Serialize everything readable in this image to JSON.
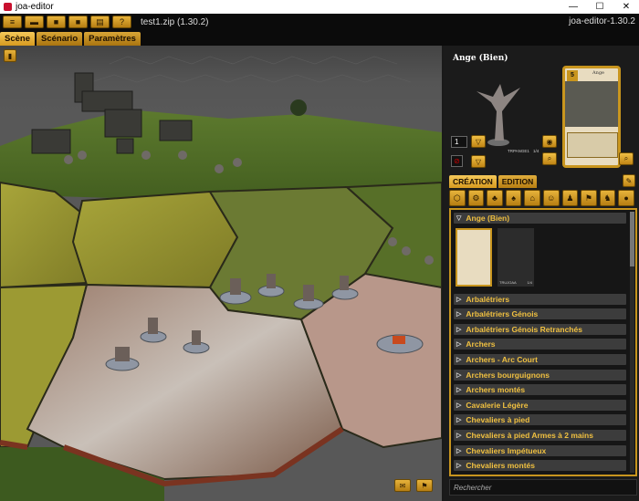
{
  "window": {
    "title": "joa-editor",
    "minimize": "—",
    "maximize": "☐",
    "close": "✕"
  },
  "toolbar": {
    "file_name": "test1.zip (1.30.2)",
    "app_version": "joa-editor-1.30.2",
    "buttons": [
      {
        "name": "menu-button",
        "icon": "menu-icon",
        "glyph": "≡"
      },
      {
        "name": "open-button",
        "icon": "folder-icon",
        "glyph": "▬"
      },
      {
        "name": "save-button",
        "icon": "floppy-icon",
        "glyph": "■"
      },
      {
        "name": "save-as-button",
        "icon": "floppy-plus-icon",
        "glyph": "■"
      },
      {
        "name": "print-button",
        "icon": "printer-icon",
        "glyph": "▤"
      },
      {
        "name": "help-button",
        "icon": "help-icon",
        "glyph": "?"
      }
    ]
  },
  "tabs": [
    {
      "label": "Scène",
      "active": true
    },
    {
      "label": "Scénario",
      "active": false
    },
    {
      "label": "Paramètres",
      "active": false
    }
  ],
  "preview": {
    "title": "Ange (Bien)",
    "quantity": "1",
    "card_label": "TRPANGE1",
    "card_count": "1/4",
    "card_name": "Ange"
  },
  "creation": {
    "tabs": [
      {
        "label": "CRÉATION",
        "active": true
      },
      {
        "label": "EDITION",
        "active": false
      }
    ],
    "categories": [
      "token-icon",
      "gear-icon",
      "group-icon",
      "tree-icon",
      "house-icon",
      "people-icon",
      "person-icon",
      "flag-icon",
      "horse-icon",
      "disc-icon"
    ],
    "expanded": {
      "label": "Ange (Bien)",
      "thumb_label": "TRUJOAA",
      "thumb_count": "1/4"
    },
    "items": [
      "Arbalétriers",
      "Arbalétriers Génois",
      "Arbalétriers Génois Retranchés",
      "Archers",
      "Archers - Arc Court",
      "Archers bourguignons",
      "Archers montés",
      "Cavalerie Légère",
      "Chevaliers à pied",
      "Chevaliers à pied Armes à 2 mains",
      "Chevaliers Impétueux",
      "Chevaliers montés"
    ],
    "search_placeholder": "Rechercher"
  },
  "colors": {
    "accent": "#d9a637",
    "item_text": "#f0c040",
    "panel_bg": "#1b1b1b"
  }
}
